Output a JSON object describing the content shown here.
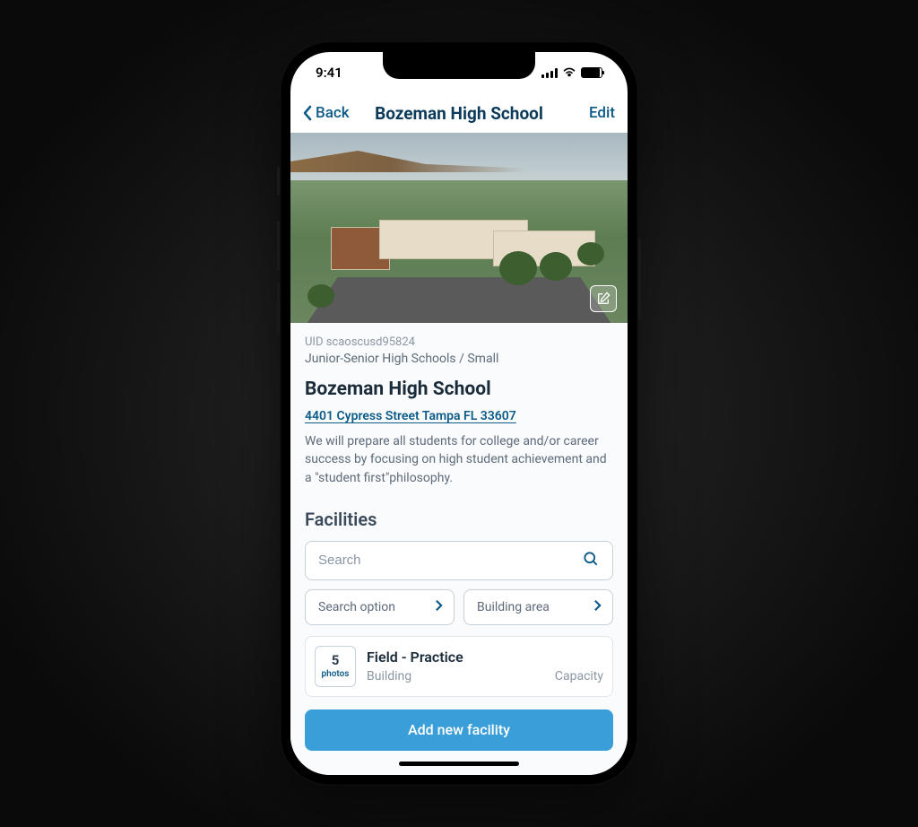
{
  "status": {
    "time": "9:41"
  },
  "nav": {
    "back": "Back",
    "title": "Bozeman High School",
    "edit": "Edit"
  },
  "detail": {
    "uid": "UID scaoscusd95824",
    "category": "Junior-Senior High Schools / Small",
    "name": "Bozeman High School",
    "address": "4401 Cypress Street Tampa FL 33607",
    "description": "We will prepare all students for college and/or career success by focusing on high student achievement and a \"student first\"philosophy."
  },
  "facilities": {
    "heading": "Facilities",
    "search_placeholder": "Search",
    "filter_option": "Search option",
    "filter_area": "Building area",
    "item": {
      "photo_count": "5",
      "photo_label": "photos",
      "name": "Field - Practice",
      "type_label": "Building",
      "capacity_label": "Capacity"
    },
    "add_button": "Add new facility"
  }
}
